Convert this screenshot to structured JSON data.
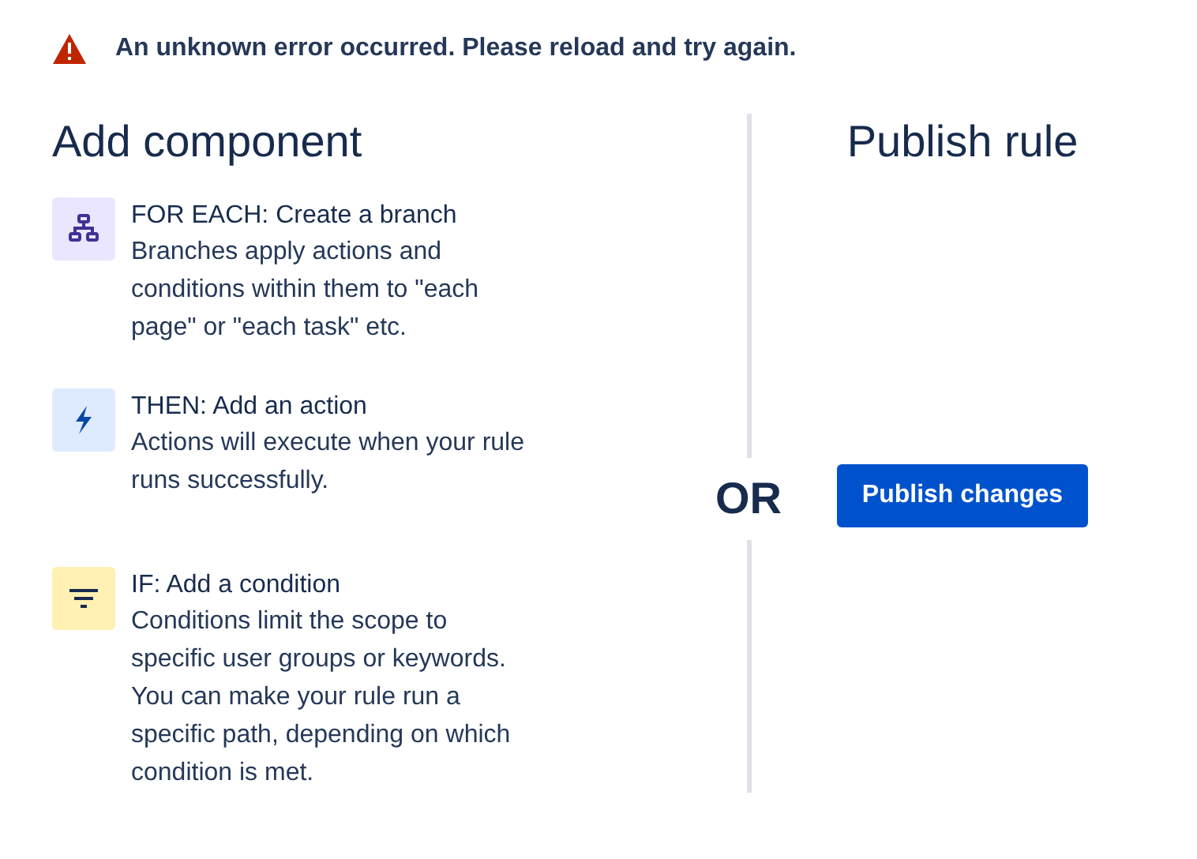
{
  "error_banner": {
    "message": "An unknown error occurred. Please reload and try again."
  },
  "add_component": {
    "title": "Add component",
    "components": [
      {
        "kind": "branch",
        "color": "#eae6ff",
        "title": "FOR EACH: Create a branch",
        "description": "Branches apply actions and conditions within them to \"each page\" or \"each task\" etc."
      },
      {
        "kind": "action",
        "color": "#deebff",
        "title": "THEN: Add an action",
        "description": "Actions will execute when your rule runs successfully."
      },
      {
        "kind": "condition",
        "color": "#fff0b3",
        "title": "IF: Add a condition",
        "description": "Conditions limit the scope to specific user groups or keywords. You can make your rule run a specific path, depending on which condition is met."
      }
    ]
  },
  "divider_label": "OR",
  "publish_rule": {
    "title": "Publish rule",
    "button": "Publish changes"
  }
}
